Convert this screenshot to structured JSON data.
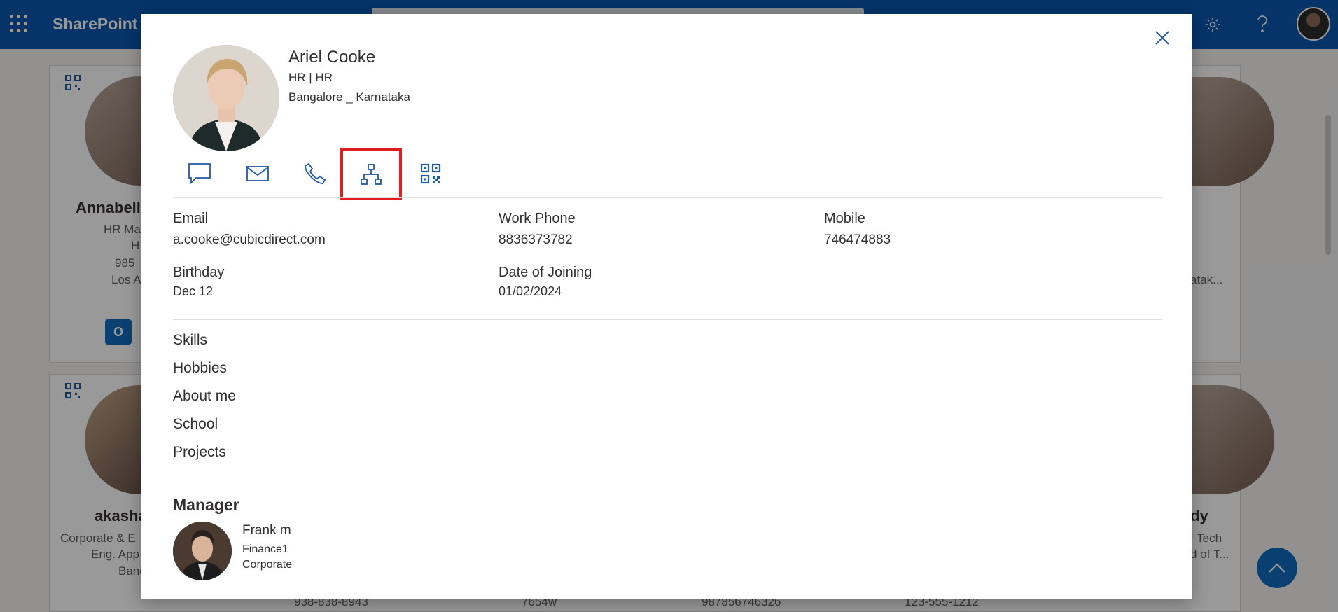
{
  "suite": {
    "brand": "SharePoint"
  },
  "background": {
    "cards": [
      {
        "name": "Annabella",
        "title": "HR Ma",
        "dept": "H",
        "phone": "985",
        "location": "Los A"
      },
      {
        "name": "akasha",
        "title": "Corporate & E",
        "dept": "Eng. App",
        "location": "Bang"
      },
      {
        "right_loc_1": "atak...",
        "right_name_2": "dy",
        "right_title_2": "f Tech",
        "right_dept_2": "d of T..."
      }
    ],
    "bottom_phones": [
      "938-838-8943",
      "7654w",
      "987856746326",
      "123-555-1212"
    ]
  },
  "profile": {
    "name": "Ariel Cooke",
    "dept_line": "HR | HR",
    "location": "Bangalore _ Karnataka",
    "actions": [
      {
        "icon": "chat-icon"
      },
      {
        "icon": "mail-icon"
      },
      {
        "icon": "phone-icon"
      },
      {
        "icon": "org-chart-icon",
        "selected": true
      },
      {
        "icon": "qr-code-icon"
      }
    ],
    "fields": {
      "email_label": "Email",
      "email_value": "a.cooke@cubicdirect.com",
      "work_phone_label": "Work Phone",
      "work_phone_value": "8836373782",
      "mobile_label": "Mobile",
      "mobile_value": "746474883",
      "birthday_label": "Birthday",
      "birthday_value": "Dec 12",
      "doj_label": "Date of Joining",
      "doj_value": "01/02/2024"
    },
    "sections": [
      "Skills",
      "Hobbies",
      "About me",
      "School",
      "Projects"
    ],
    "manager": {
      "heading": "Manager",
      "name": "Frank m",
      "dept": "Finance1",
      "division": "Corporate"
    }
  },
  "colors": {
    "suite_bar": "#0a58b0",
    "icon_blue": "#1f5aa6",
    "highlight": "#e11d1d"
  }
}
